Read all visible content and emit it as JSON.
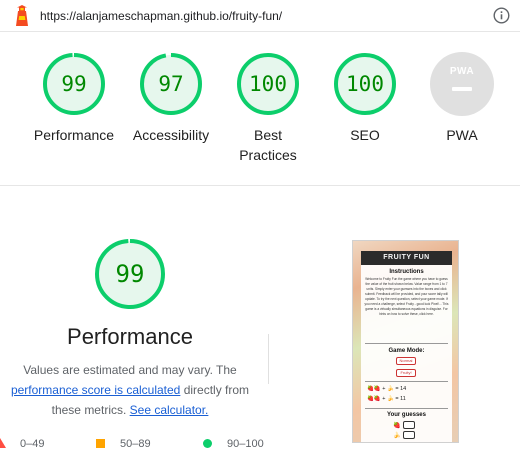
{
  "urlbar": {
    "url": "https://alanjameschapman.github.io/fruity-fun/",
    "logo_icon": "lighthouse-icon",
    "info_icon": "info-circle-icon"
  },
  "gauges": [
    {
      "key": "performance",
      "label": "Performance",
      "score": "99",
      "color": "#0cce6b"
    },
    {
      "key": "accessibility",
      "label": "Accessibility",
      "score": "97",
      "color": "#0cce6b"
    },
    {
      "key": "best-practices",
      "label": "Best Practices",
      "score": "100",
      "color": "#0cce6b"
    },
    {
      "key": "seo",
      "label": "SEO",
      "score": "100",
      "color": "#0cce6b"
    },
    {
      "key": "pwa",
      "label": "PWA",
      "badge": "PWA",
      "color": "#e0e0e0"
    }
  ],
  "performance_section": {
    "score": "99",
    "title": "Performance",
    "desc_prefix": "Values are estimated and may vary. The ",
    "link_score": "performance score is calculated",
    "desc_middle": " directly from these metrics. ",
    "link_calc": "See calculator."
  },
  "legend": [
    {
      "shape": "triangle",
      "color": "#ff4e42",
      "range": "0–49"
    },
    {
      "shape": "square",
      "color": "#ffa400",
      "range": "50–89"
    },
    {
      "shape": "circle",
      "color": "#0cce6b",
      "range": "90–100"
    }
  ],
  "thumbnail": {
    "header": "FRUITY FUN",
    "instructions_title": "Instructions",
    "instructions_text": "Welcome to Fruity Fun the game where you have to guess the value of the fruit shown below. Value range from 1 to 7 units. Simply enter your guesses into the boxes and click submit. Feedback will be provided, and your score tally will update. To try the next question, select your game mode. If you need a challenge, select Fruity - good luck Pixel!... This game is a virtually simultaneous equations in disguise. For hints on how to solve these, click here.",
    "game_mode_title": "Game Mode:",
    "normal_button": "Normal",
    "fruity_button": "Fruity!",
    "equation1": "🍓🍓 + 🍌 = 14",
    "equation2": "🍓🍓 + 🍌 = 11",
    "your_guesses": "Your guesses"
  }
}
